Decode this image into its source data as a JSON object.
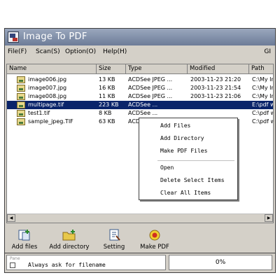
{
  "window": {
    "title": "Image To PDF"
  },
  "menubar": {
    "items": [
      {
        "label": "File(F)"
      },
      {
        "label": "Scan(S)"
      },
      {
        "label": "Option(O)"
      },
      {
        "label": "Help(H)"
      }
    ],
    "right_label": "GI"
  },
  "list": {
    "columns": [
      "Name",
      "Size",
      "Type",
      "Modified",
      "Path"
    ],
    "rows": [
      {
        "name": "image006.jpg",
        "size": "13 KB",
        "type": "ACDSee JPEG ...",
        "modified": "2003-11-23 21:20",
        "path": "C:\\My In",
        "selected": false
      },
      {
        "name": "image007.jpg",
        "size": "16 KB",
        "type": "ACDSee JPEG ...",
        "modified": "2003-11-23 21:54",
        "path": "C:\\My In",
        "selected": false
      },
      {
        "name": "image008.jpg",
        "size": "11 KB",
        "type": "ACDSee JPEG ...",
        "modified": "2003-11-23 21:06",
        "path": "C:\\My In",
        "selected": false
      },
      {
        "name": "multipage.tif",
        "size": "223 KB",
        "type": "ACDSee ...",
        "modified": "",
        "path": "E:\\pdf w",
        "selected": true
      },
      {
        "name": "test1.tif",
        "size": "8 KB",
        "type": "ACDSee ...",
        "modified": "",
        "path": "C:\\pdf w",
        "selected": false
      },
      {
        "name": "sample_jpeg.TIF",
        "size": "63 KB",
        "type": "ACDSee ...",
        "modified": "",
        "path": "C:\\pdf w",
        "selected": false
      }
    ]
  },
  "context_menu": {
    "items": [
      {
        "label": "Add Files"
      },
      {
        "label": "Add Directory"
      },
      {
        "label": "Make PDF Files"
      },
      {
        "label": "Open"
      },
      {
        "label": "Delete Select Items"
      },
      {
        "label": "Clear All Items"
      }
    ]
  },
  "toolbar": {
    "buttons": [
      {
        "label": "Add files",
        "icon": "add-files-icon"
      },
      {
        "label": "Add directory",
        "icon": "add-directory-icon"
      },
      {
        "label": "Setting",
        "icon": "setting-icon"
      },
      {
        "label": "Make PDF",
        "icon": "make-pdf-icon"
      }
    ]
  },
  "status": {
    "faint_text": "Pane",
    "checkbox_label": "Always ask for filename",
    "checkbox_checked": false,
    "right_text": "0%"
  },
  "colors": {
    "selection": "#0a246a",
    "titlebar": "#6d7c98",
    "face": "#d4d0c8"
  }
}
